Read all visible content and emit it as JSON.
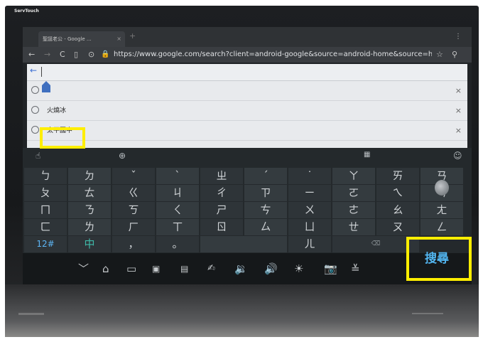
{
  "device": {
    "brand": "ServTouch"
  },
  "browser": {
    "tab_title": "聖誕老公 - Google ...",
    "tab_close": "×",
    "new_tab": "+",
    "url": "https://www.google.com/search?client=android-google&source=android-home&source=hp"
  },
  "omnibox": {
    "back_arrow": "←"
  },
  "suggestions": [
    {
      "label": "",
      "clear": "×"
    },
    {
      "label": "火燒冰",
      "clear": "×"
    },
    {
      "label": "太平國中",
      "clear": "×"
    }
  ],
  "keyboard": {
    "rows": [
      [
        "ㄅ",
        "ㄉ",
        "ˇ",
        "ˋ",
        "ㄓ",
        "ˊ",
        "˙",
        "ㄚ",
        "ㄞ",
        "ㄢ"
      ],
      [
        "ㄆ",
        "ㄊ",
        "ㄍ",
        "ㄐ",
        "ㄔ",
        "ㄗ",
        "ㄧ",
        "ㄛ",
        "ㄟ",
        "ㄣ"
      ],
      [
        "ㄇ",
        "ㄋ",
        "ㄎ",
        "ㄑ",
        "ㄕ",
        "ㄘ",
        "ㄨ",
        "ㄜ",
        "ㄠ",
        "ㄤ"
      ],
      [
        "ㄈ",
        "ㄌ",
        "ㄏ",
        "ㄒ",
        "ㄖ",
        "ㄙ",
        "ㄩ",
        "ㄝ",
        "ㄡ",
        "ㄥ"
      ]
    ],
    "bottom_row": {
      "symbols": "12#",
      "lang": "中",
      "comma": "，",
      "period": "。",
      "er": "ㄦ",
      "delete": "⌫",
      "search": "搜尋"
    }
  },
  "icons": {
    "colors": {
      "highlight": "#ffee00",
      "search_text": "#52b6f1",
      "teal": "#3fb9a9"
    }
  }
}
